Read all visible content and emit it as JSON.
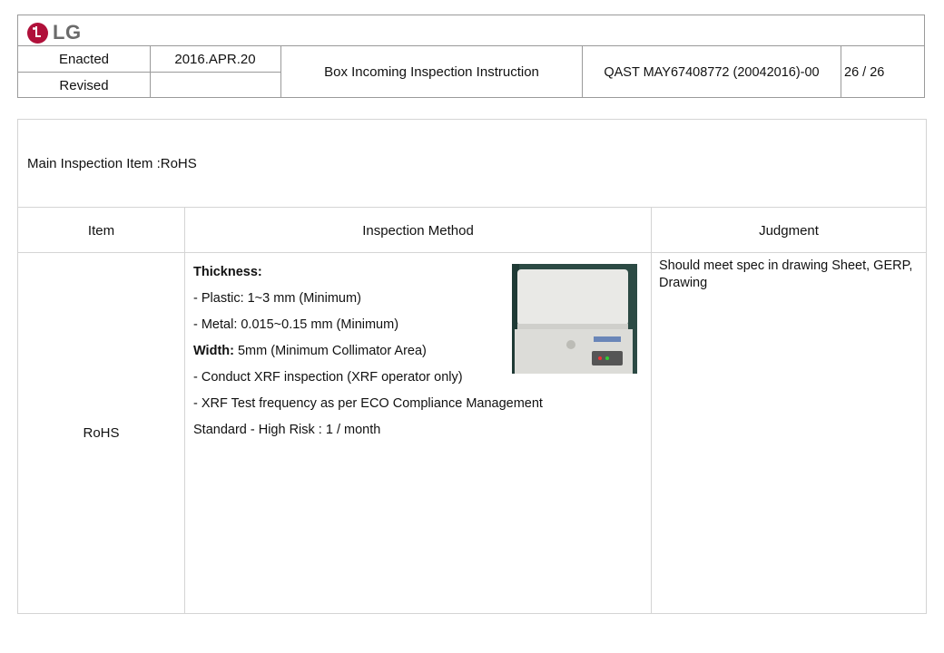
{
  "header": {
    "brand": "LG",
    "enacted_label": "Enacted",
    "enacted_date": "2016.APR.20",
    "revised_label": "Revised",
    "revised_date": "",
    "doc_title": "Box Incoming Inspection Instruction",
    "doc_code": "QAST MAY67408772 (20042016)-00",
    "page": "26 / 26"
  },
  "main": {
    "title": "Main Inspection Item :RoHS",
    "columns": [
      "Item",
      "Inspection Method",
      "Judgment"
    ],
    "row": {
      "item": "RoHS",
      "method": {
        "thickness_label": "Thickness:",
        "plastic": "-  Plastic: 1~3 mm (Minimum)",
        "metal": "-  Metal: 0.015~0.15 mm (Minimum)",
        "width_label": "Width:",
        "width_value": " 5mm (Minimum Collimator Area)",
        "conduct": "-  Conduct XRF inspection (XRF operator only)",
        "frequency": "-  XRF Test frequency as per ECO Compliance Management",
        "standard": "Standard - High Risk : 1 / month"
      },
      "judgment": "Should meet spec in drawing Sheet, GERP, Drawing"
    }
  }
}
